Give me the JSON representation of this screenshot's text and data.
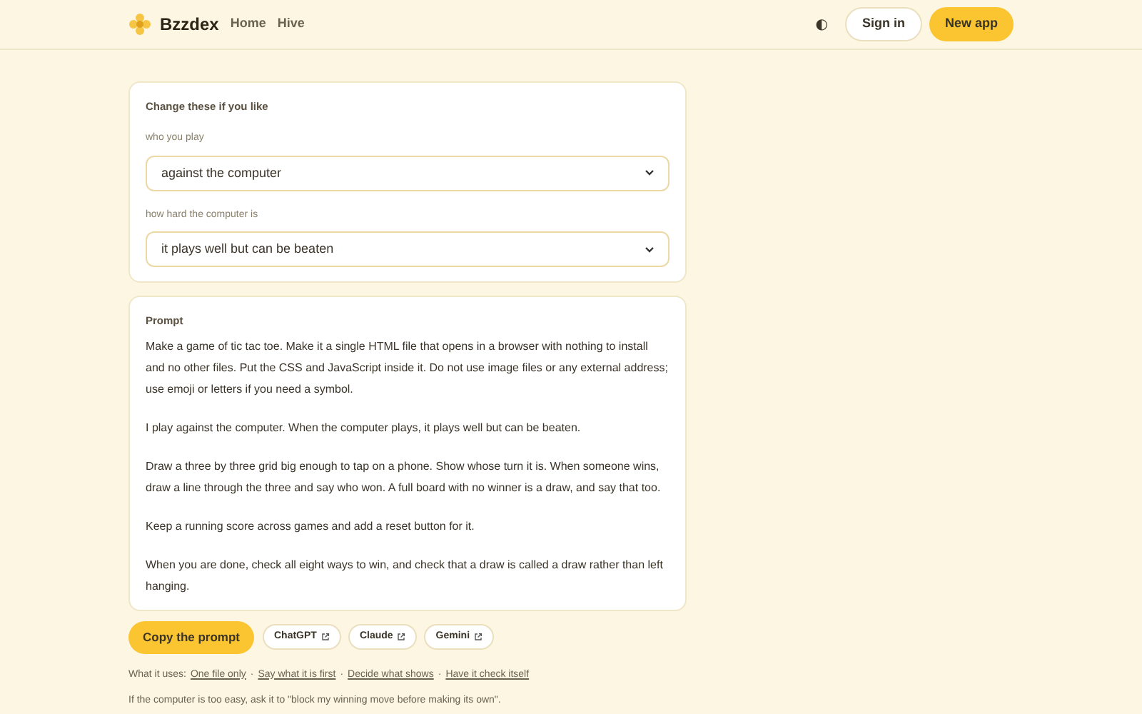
{
  "header": {
    "brand": "Bzzdex",
    "nav": [
      "Home",
      "Hive"
    ],
    "theme_icon": "◐",
    "sign_in": "Sign in",
    "new_app": "New app"
  },
  "settings": {
    "title": "Change these if you like",
    "fields": [
      {
        "label": "who you play",
        "value": "against the computer"
      },
      {
        "label": "how hard the computer is",
        "value": "it plays well but can be beaten"
      }
    ]
  },
  "prompt": {
    "title": "Prompt",
    "paragraphs": [
      "Make a game of tic tac toe. Make it a single HTML file that opens in a browser with nothing to install and no other files. Put the CSS and JavaScript inside it. Do not use image files or any external address; use emoji or letters if you need a symbol.",
      "I play against the computer. When the computer plays, it plays well but can be beaten.",
      "Draw a three by three grid big enough to tap on a phone. Show whose turn it is. When someone wins, draw a line through the three and say who won. A full board with no winner is a draw, and say that too.",
      "Keep a running score across games and add a reset button for it.",
      "When you are done, check all eight ways to win, and check that a draw is called a draw rather than left hanging."
    ]
  },
  "actions": {
    "copy": "Copy the prompt",
    "links": [
      "ChatGPT",
      "Claude",
      "Gemini"
    ]
  },
  "uses": {
    "label": "What it uses:",
    "separator": "·",
    "links": [
      "One file only",
      "Say what it is first",
      "Decide what shows",
      "Have it check itself"
    ]
  },
  "tip": "If the computer is too easy, ask it to \"block my winning move before making its own\"."
}
